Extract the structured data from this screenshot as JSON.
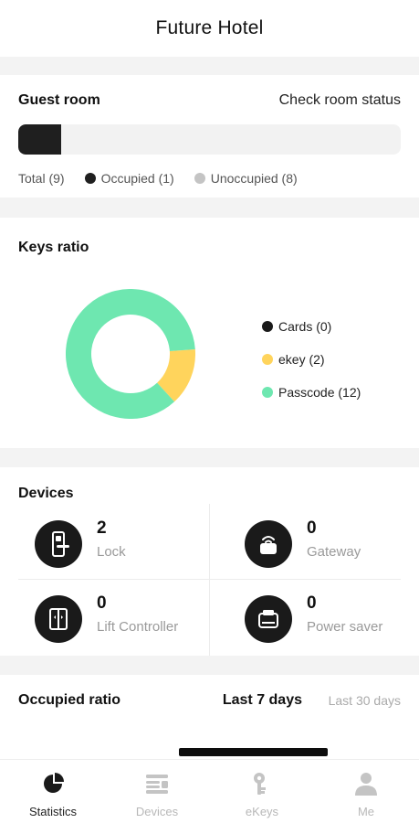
{
  "header": {
    "title": "Future Hotel"
  },
  "guest_room": {
    "title": "Guest room",
    "link": "Check room status",
    "occupied_fraction": 0.111,
    "total": "Total (9)",
    "occupied": "Occupied (1)",
    "unoccupied": "Unoccupied (8)",
    "colors": {
      "occupied": "#1f1f1f",
      "unoccupied": "#c4c4c4",
      "track": "#f2f2f2"
    }
  },
  "keys_ratio": {
    "title": "Keys ratio",
    "legend": [
      {
        "label": "Cards (0)",
        "value": 0,
        "color": "#1a1a1a"
      },
      {
        "label": "ekey (2)",
        "value": 2,
        "color": "#ffd45c"
      },
      {
        "label": "Passcode (12)",
        "value": 12,
        "color": "#6ee7b0"
      }
    ]
  },
  "devices": {
    "title": "Devices",
    "items": [
      {
        "count": "2",
        "label": "Lock",
        "icon": "lock-icon"
      },
      {
        "count": "0",
        "label": "Gateway",
        "icon": "gateway-icon"
      },
      {
        "count": "0",
        "label": "Lift Controller",
        "icon": "lift-controller-icon"
      },
      {
        "count": "0",
        "label": "Power saver",
        "icon": "power-saver-icon"
      }
    ]
  },
  "occupied_ratio": {
    "title": "Occupied ratio",
    "options": [
      "Last 7 days",
      "Last 30 days"
    ],
    "selected": "Last 7 days"
  },
  "tabbar": {
    "tabs": [
      {
        "label": "Statistics",
        "icon": "pie-chart-icon",
        "active": true
      },
      {
        "label": "Devices",
        "icon": "devices-list-icon",
        "active": false
      },
      {
        "label": "eKeys",
        "icon": "key-icon",
        "active": false
      },
      {
        "label": "Me",
        "icon": "person-icon",
        "active": false
      }
    ]
  }
}
